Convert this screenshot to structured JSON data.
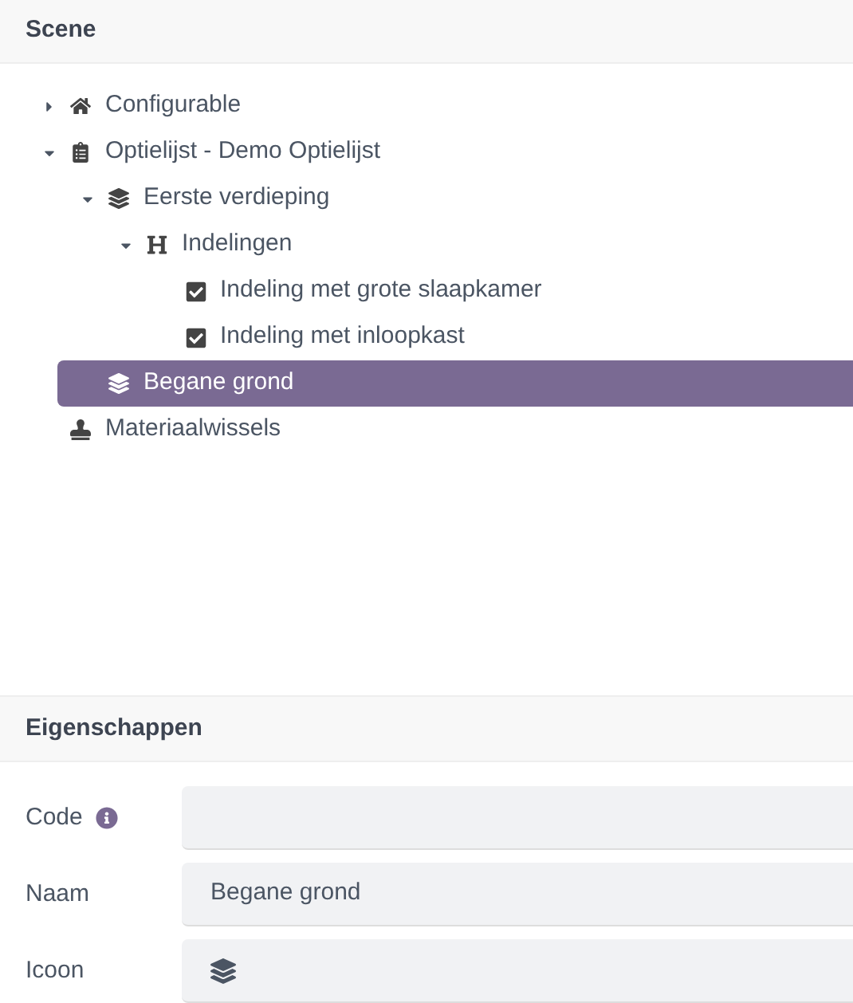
{
  "scene": {
    "title": "Scene",
    "tree": [
      {
        "label": "Configurable",
        "kind": "home",
        "expanded": false,
        "selected": false
      },
      {
        "label": "Optielijst - Demo Optielijst",
        "kind": "list",
        "expanded": true,
        "selected": false,
        "children": [
          {
            "label": "Eerste verdieping",
            "kind": "layers",
            "expanded": true,
            "selected": false,
            "children": [
              {
                "label": "Indelingen",
                "kind": "heading",
                "expanded": true,
                "selected": false,
                "children": [
                  {
                    "label": "Indeling met grote slaapkamer",
                    "kind": "checkbox",
                    "checked": true,
                    "selected": false
                  },
                  {
                    "label": "Indeling met inloopkast",
                    "kind": "checkbox",
                    "checked": true,
                    "selected": false
                  }
                ]
              }
            ]
          },
          {
            "label": "Begane grond",
            "kind": "layers",
            "selected": true
          }
        ]
      },
      {
        "label": "Materiaalwissels",
        "kind": "stamp",
        "selected": false
      }
    ]
  },
  "properties": {
    "title": "Eigenschappen",
    "fields": [
      {
        "label": "Code",
        "kind": "text",
        "info": true
      },
      {
        "label": "Naam",
        "kind": "select",
        "value": "Begane grond",
        "info": false
      },
      {
        "label": "Icoon",
        "kind": "icon-select",
        "info": false
      }
    ]
  }
}
